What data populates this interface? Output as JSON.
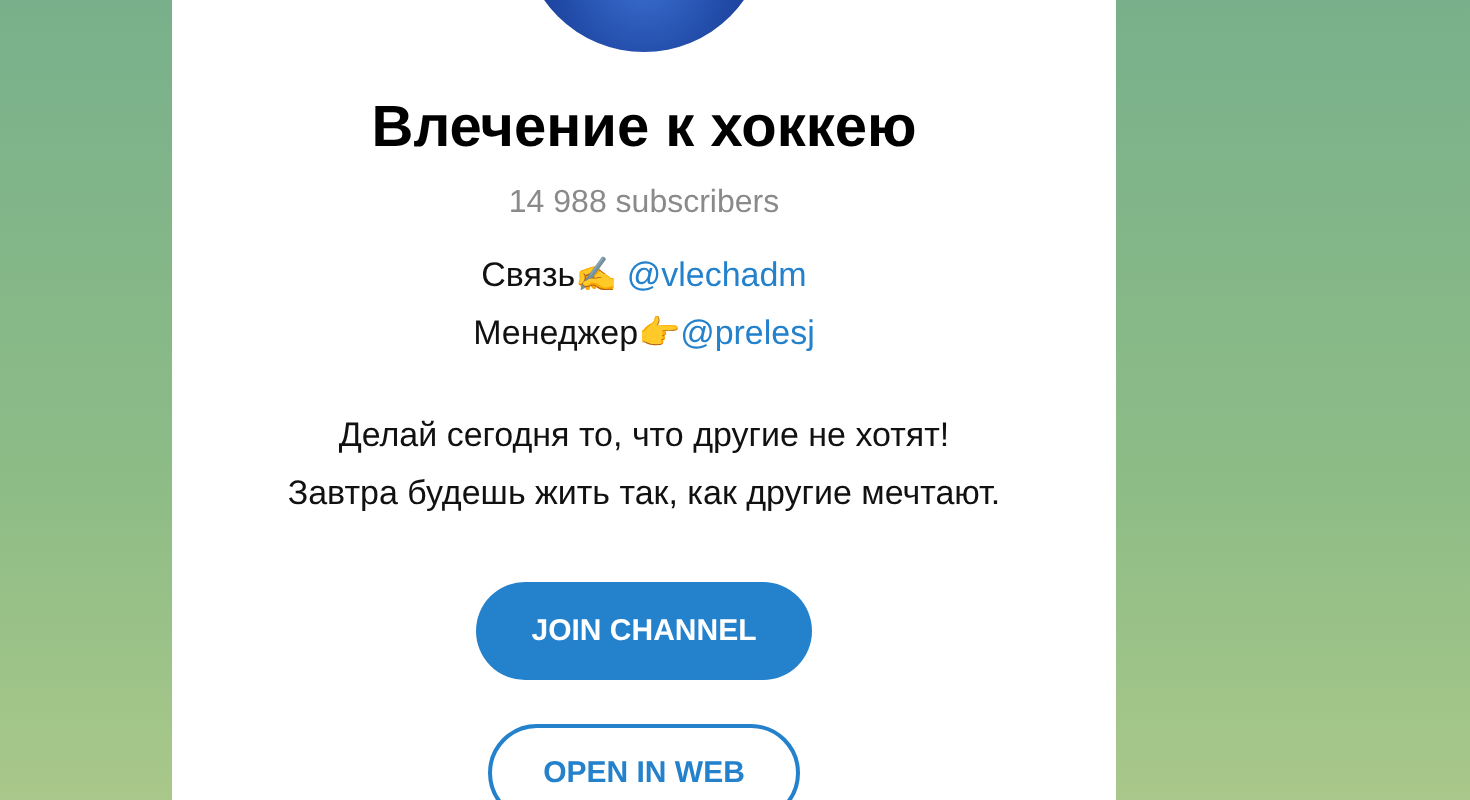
{
  "channel": {
    "title": "Влечение к хоккею",
    "subscribers": "14 988 subscribers"
  },
  "contacts": [
    {
      "text": "Связь✍️ ",
      "link": "@vlechadm"
    },
    {
      "text": "Менеджер👉",
      "link": "@prelesj"
    }
  ],
  "description": [
    "Делай сегодня то, что другие не хотят!",
    "Завтра будешь жить так, как другие мечтают."
  ],
  "buttons": [
    {
      "label": "JOIN CHANNEL",
      "kind": "primary"
    },
    {
      "label": "OPEN IN WEB",
      "kind": "outline"
    }
  ]
}
